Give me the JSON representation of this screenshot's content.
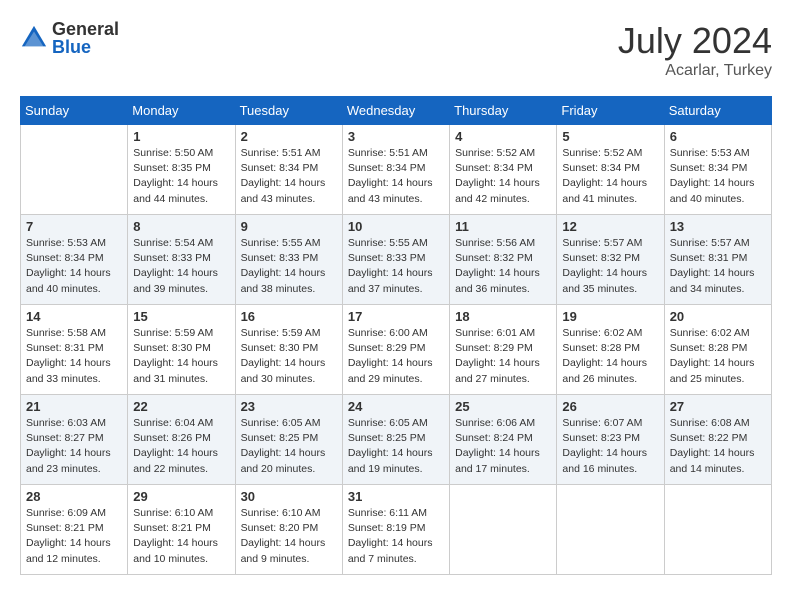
{
  "header": {
    "logo": {
      "general": "General",
      "blue": "Blue"
    },
    "month_year": "July 2024",
    "location": "Acarlar, Turkey"
  },
  "weekdays": [
    "Sunday",
    "Monday",
    "Tuesday",
    "Wednesday",
    "Thursday",
    "Friday",
    "Saturday"
  ],
  "weeks": [
    [
      {
        "day": "",
        "info": ""
      },
      {
        "day": "1",
        "info": "Sunrise: 5:50 AM\nSunset: 8:35 PM\nDaylight: 14 hours\nand 44 minutes."
      },
      {
        "day": "2",
        "info": "Sunrise: 5:51 AM\nSunset: 8:34 PM\nDaylight: 14 hours\nand 43 minutes."
      },
      {
        "day": "3",
        "info": "Sunrise: 5:51 AM\nSunset: 8:34 PM\nDaylight: 14 hours\nand 43 minutes."
      },
      {
        "day": "4",
        "info": "Sunrise: 5:52 AM\nSunset: 8:34 PM\nDaylight: 14 hours\nand 42 minutes."
      },
      {
        "day": "5",
        "info": "Sunrise: 5:52 AM\nSunset: 8:34 PM\nDaylight: 14 hours\nand 41 minutes."
      },
      {
        "day": "6",
        "info": "Sunrise: 5:53 AM\nSunset: 8:34 PM\nDaylight: 14 hours\nand 40 minutes."
      }
    ],
    [
      {
        "day": "7",
        "info": "Sunrise: 5:53 AM\nSunset: 8:34 PM\nDaylight: 14 hours\nand 40 minutes."
      },
      {
        "day": "8",
        "info": "Sunrise: 5:54 AM\nSunset: 8:33 PM\nDaylight: 14 hours\nand 39 minutes."
      },
      {
        "day": "9",
        "info": "Sunrise: 5:55 AM\nSunset: 8:33 PM\nDaylight: 14 hours\nand 38 minutes."
      },
      {
        "day": "10",
        "info": "Sunrise: 5:55 AM\nSunset: 8:33 PM\nDaylight: 14 hours\nand 37 minutes."
      },
      {
        "day": "11",
        "info": "Sunrise: 5:56 AM\nSunset: 8:32 PM\nDaylight: 14 hours\nand 36 minutes."
      },
      {
        "day": "12",
        "info": "Sunrise: 5:57 AM\nSunset: 8:32 PM\nDaylight: 14 hours\nand 35 minutes."
      },
      {
        "day": "13",
        "info": "Sunrise: 5:57 AM\nSunset: 8:31 PM\nDaylight: 14 hours\nand 34 minutes."
      }
    ],
    [
      {
        "day": "14",
        "info": "Sunrise: 5:58 AM\nSunset: 8:31 PM\nDaylight: 14 hours\nand 33 minutes."
      },
      {
        "day": "15",
        "info": "Sunrise: 5:59 AM\nSunset: 8:30 PM\nDaylight: 14 hours\nand 31 minutes."
      },
      {
        "day": "16",
        "info": "Sunrise: 5:59 AM\nSunset: 8:30 PM\nDaylight: 14 hours\nand 30 minutes."
      },
      {
        "day": "17",
        "info": "Sunrise: 6:00 AM\nSunset: 8:29 PM\nDaylight: 14 hours\nand 29 minutes."
      },
      {
        "day": "18",
        "info": "Sunrise: 6:01 AM\nSunset: 8:29 PM\nDaylight: 14 hours\nand 27 minutes."
      },
      {
        "day": "19",
        "info": "Sunrise: 6:02 AM\nSunset: 8:28 PM\nDaylight: 14 hours\nand 26 minutes."
      },
      {
        "day": "20",
        "info": "Sunrise: 6:02 AM\nSunset: 8:28 PM\nDaylight: 14 hours\nand 25 minutes."
      }
    ],
    [
      {
        "day": "21",
        "info": "Sunrise: 6:03 AM\nSunset: 8:27 PM\nDaylight: 14 hours\nand 23 minutes."
      },
      {
        "day": "22",
        "info": "Sunrise: 6:04 AM\nSunset: 8:26 PM\nDaylight: 14 hours\nand 22 minutes."
      },
      {
        "day": "23",
        "info": "Sunrise: 6:05 AM\nSunset: 8:25 PM\nDaylight: 14 hours\nand 20 minutes."
      },
      {
        "day": "24",
        "info": "Sunrise: 6:05 AM\nSunset: 8:25 PM\nDaylight: 14 hours\nand 19 minutes."
      },
      {
        "day": "25",
        "info": "Sunrise: 6:06 AM\nSunset: 8:24 PM\nDaylight: 14 hours\nand 17 minutes."
      },
      {
        "day": "26",
        "info": "Sunrise: 6:07 AM\nSunset: 8:23 PM\nDaylight: 14 hours\nand 16 minutes."
      },
      {
        "day": "27",
        "info": "Sunrise: 6:08 AM\nSunset: 8:22 PM\nDaylight: 14 hours\nand 14 minutes."
      }
    ],
    [
      {
        "day": "28",
        "info": "Sunrise: 6:09 AM\nSunset: 8:21 PM\nDaylight: 14 hours\nand 12 minutes."
      },
      {
        "day": "29",
        "info": "Sunrise: 6:10 AM\nSunset: 8:21 PM\nDaylight: 14 hours\nand 10 minutes."
      },
      {
        "day": "30",
        "info": "Sunrise: 6:10 AM\nSunset: 8:20 PM\nDaylight: 14 hours\nand 9 minutes."
      },
      {
        "day": "31",
        "info": "Sunrise: 6:11 AM\nSunset: 8:19 PM\nDaylight: 14 hours\nand 7 minutes."
      },
      {
        "day": "",
        "info": ""
      },
      {
        "day": "",
        "info": ""
      },
      {
        "day": "",
        "info": ""
      }
    ]
  ]
}
